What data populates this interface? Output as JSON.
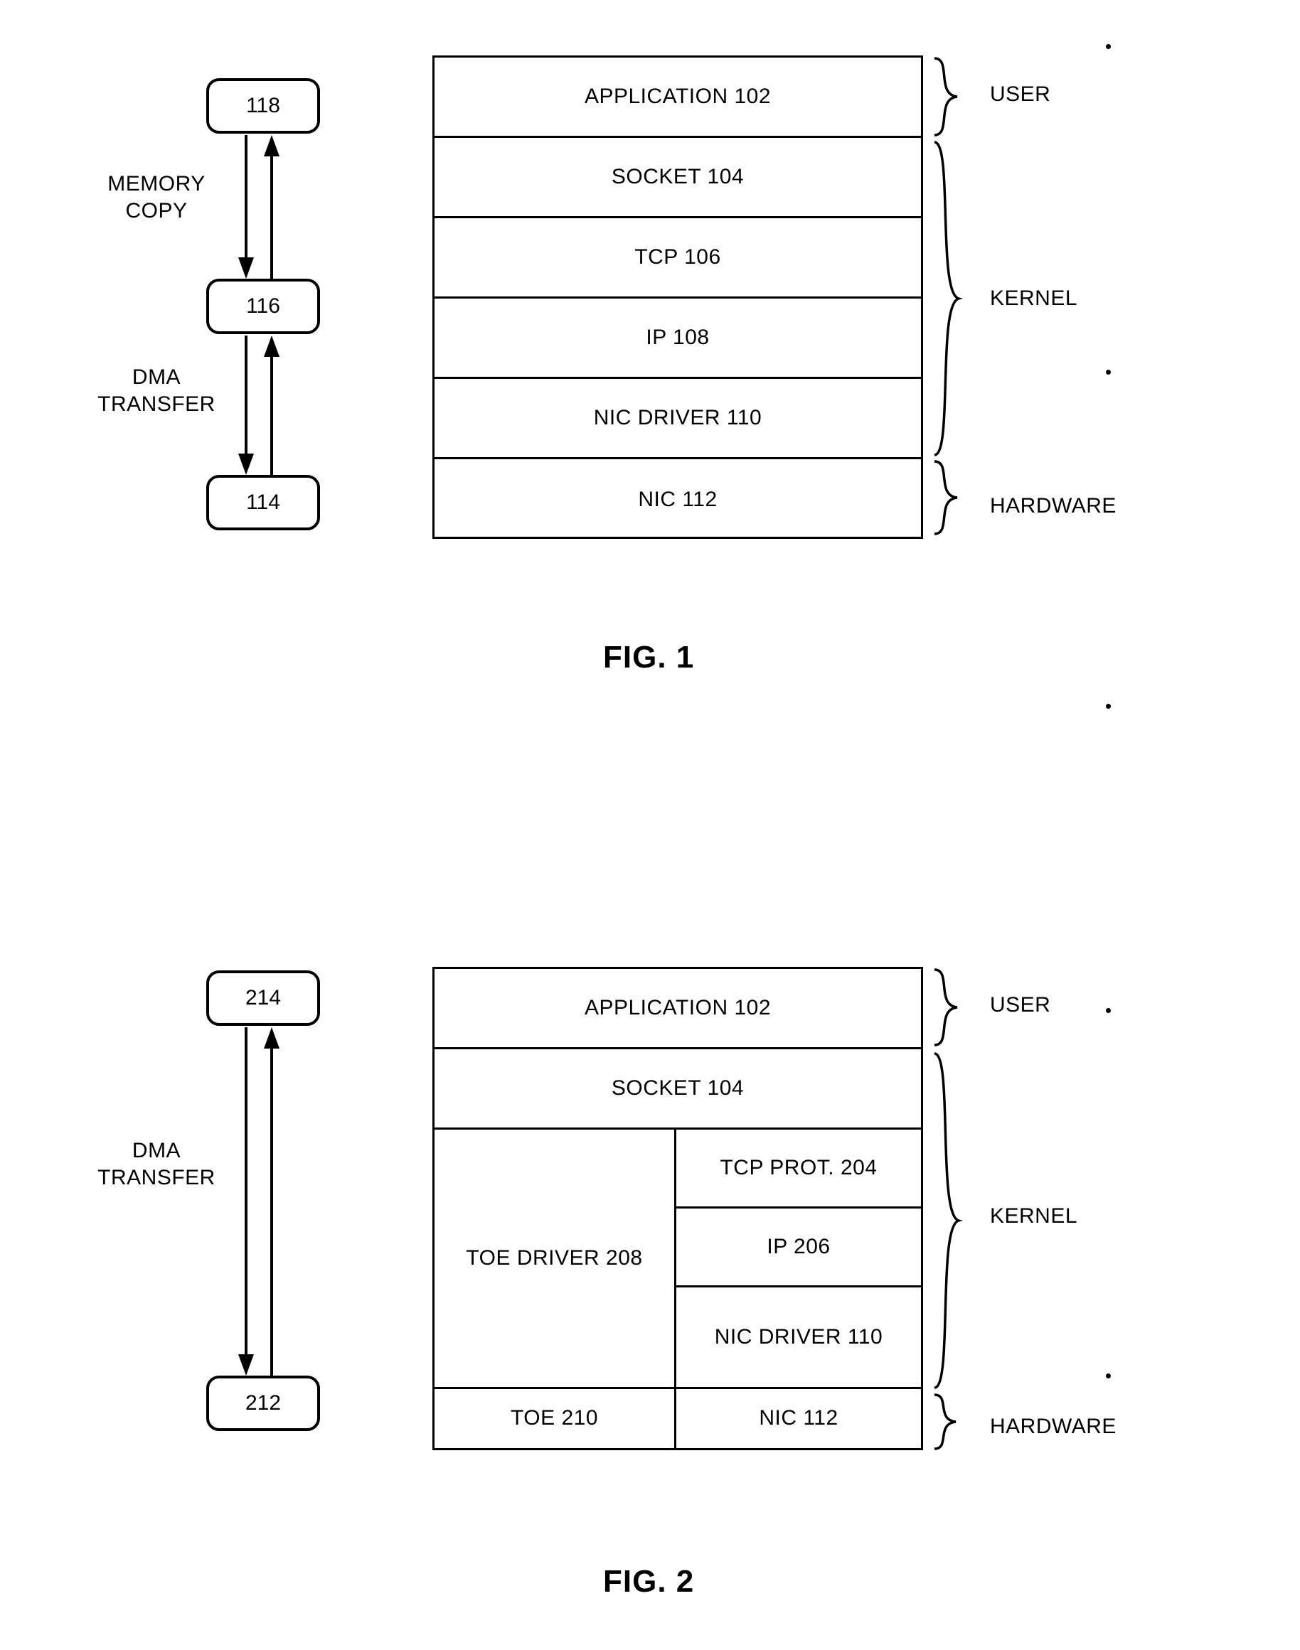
{
  "figures": [
    {
      "caption": "FIG. 1",
      "stack_layers": [
        {
          "label": "APPLICATION 102"
        },
        {
          "label": "SOCKET 104"
        },
        {
          "label": "TCP 106"
        },
        {
          "label": "IP 108"
        },
        {
          "label": "NIC DRIVER 110"
        },
        {
          "label": "NIC 112"
        }
      ],
      "zones": [
        {
          "label": "USER"
        },
        {
          "label": "KERNEL"
        },
        {
          "label": "HARDWARE"
        }
      ],
      "refs": [
        {
          "label": "118"
        },
        {
          "label": "116"
        },
        {
          "label": "114"
        }
      ],
      "arrow_labels": [
        {
          "label": "MEMORY\nCOPY"
        },
        {
          "label": "DMA\nTRANSFER"
        }
      ]
    },
    {
      "caption": "FIG. 2",
      "stack_layers": [
        {
          "label": "APPLICATION 102"
        },
        {
          "label": "SOCKET 104"
        },
        {
          "label": "TOE\nDRIVER 208"
        },
        {
          "label": "TCP PROT. 204"
        },
        {
          "label": "IP 206"
        },
        {
          "label": "NIC DRIVER\n110"
        },
        {
          "label": "TOE 210"
        },
        {
          "label": "NIC 112"
        }
      ],
      "zones": [
        {
          "label": "USER"
        },
        {
          "label": "KERNEL"
        },
        {
          "label": "HARDWARE"
        }
      ],
      "refs": [
        {
          "label": "214"
        },
        {
          "label": "212"
        }
      ],
      "arrow_labels": [
        {
          "label": "DMA\nTRANSFER"
        }
      ]
    }
  ]
}
